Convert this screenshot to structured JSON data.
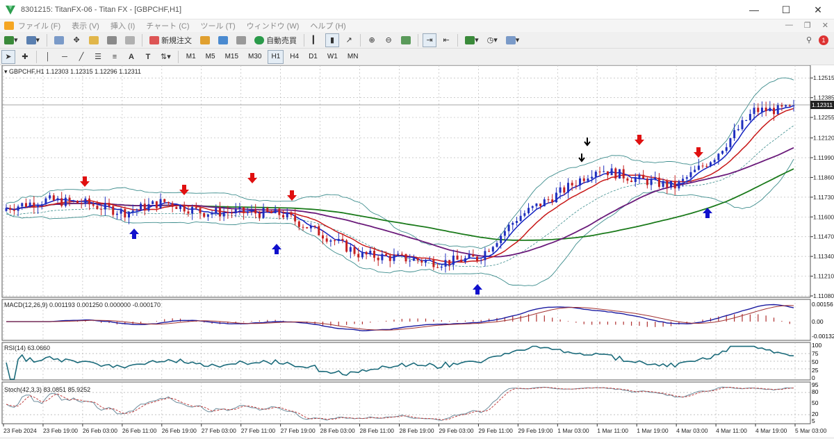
{
  "window": {
    "title": "8301215: TitanFX-06 - Titan FX - [GBPCHF,H1]"
  },
  "menu": [
    {
      "label": "ファイル (F)"
    },
    {
      "label": "表示 (V)"
    },
    {
      "label": "挿入 (I)"
    },
    {
      "label": "チャート (C)"
    },
    {
      "label": "ツール (T)"
    },
    {
      "label": "ウィンドウ (W)"
    },
    {
      "label": "ヘルプ (H)"
    }
  ],
  "toolbar": {
    "new_order": "新規注文",
    "auto_trade": "自動売買"
  },
  "timeframes": [
    "M1",
    "M5",
    "M15",
    "M30",
    "H1",
    "H4",
    "D1",
    "W1",
    "MN"
  ],
  "active_timeframe": "H1",
  "chart": {
    "symbol_header": "GBPCHF,H1  1.12303 1.12315 1.12296 1.12311",
    "current_price": "1.12311",
    "price_ticks": [
      "1.12515",
      "1.12385",
      "1.12255",
      "1.12120",
      "1.11990",
      "1.11860",
      "1.11730",
      "1.11600",
      "1.11470",
      "1.11340",
      "1.11210",
      "1.11080"
    ],
    "dates": [
      "23 Feb 2024",
      "23 Feb 19:00",
      "26 Feb 03:00",
      "26 Feb 11:00",
      "26 Feb 19:00",
      "27 Feb 03:00",
      "27 Feb 11:00",
      "27 Feb 19:00",
      "28 Feb 03:00",
      "28 Feb 11:00",
      "28 Feb 19:00",
      "29 Feb 03:00",
      "29 Feb 11:00",
      "29 Feb 19:00",
      "1 Mar 03:00",
      "1 Mar 11:00",
      "1 Mar 19:00",
      "4 Mar 03:00",
      "4 Mar 11:00",
      "4 Mar 19:00",
      "5 Mar 03:00"
    ]
  },
  "macd": {
    "header": "MACD(12,26,9) 0.001193 0.001250 0.000000 -0.000170",
    "ticks": [
      "0.00156",
      "0.00",
      "-0.00132"
    ]
  },
  "rsi": {
    "header": "RSI(14) 63.0660",
    "ticks": [
      "100",
      "75",
      "50",
      "25",
      "0"
    ]
  },
  "stoch": {
    "header": "Stoch(42,3,3) 83.0851 85.9252",
    "ticks": [
      "95",
      "80",
      "50",
      "20",
      "5"
    ]
  },
  "colors": {
    "bull": "#1f2fbf",
    "bear": "#c62020",
    "sell_arrow": "#e01010",
    "buy_arrow": "#1010cc"
  },
  "chart_data": {
    "type": "candlestick",
    "symbol": "GBPCHF",
    "timeframe": "H1",
    "last": 1.12311,
    "ylim": [
      1.1108,
      1.1258
    ],
    "approx_close_path": [
      {
        "x": "23 Feb 2024",
        "y": 1.1166
      },
      {
        "x": "23 Feb 19:00",
        "y": 1.1171
      },
      {
        "x": "26 Feb 03:00",
        "y": 1.1169
      },
      {
        "x": "26 Feb 11:00",
        "y": 1.1163
      },
      {
        "x": "26 Feb 19:00",
        "y": 1.117
      },
      {
        "x": "27 Feb 03:00",
        "y": 1.1163
      },
      {
        "x": "27 Feb 11:00",
        "y": 1.1163
      },
      {
        "x": "27 Feb 19:00",
        "y": 1.1162
      },
      {
        "x": "28 Feb 03:00",
        "y": 1.1149
      },
      {
        "x": "28 Feb 11:00",
        "y": 1.1135
      },
      {
        "x": "28 Feb 19:00",
        "y": 1.1133
      },
      {
        "x": "29 Feb 03:00",
        "y": 1.113
      },
      {
        "x": "29 Feb 11:00",
        "y": 1.1133
      },
      {
        "x": "29 Feb 19:00",
        "y": 1.116
      },
      {
        "x": "1 Mar 03:00",
        "y": 1.1175
      },
      {
        "x": "1 Mar 11:00",
        "y": 1.1192
      },
      {
        "x": "1 Mar 19:00",
        "y": 1.1185
      },
      {
        "x": "4 Mar 03:00",
        "y": 1.118
      },
      {
        "x": "4 Mar 11:00",
        "y": 1.12
      },
      {
        "x": "4 Mar 19:00",
        "y": 1.123
      },
      {
        "x": "5 Mar 03:00",
        "y": 1.1231
      }
    ]
  }
}
